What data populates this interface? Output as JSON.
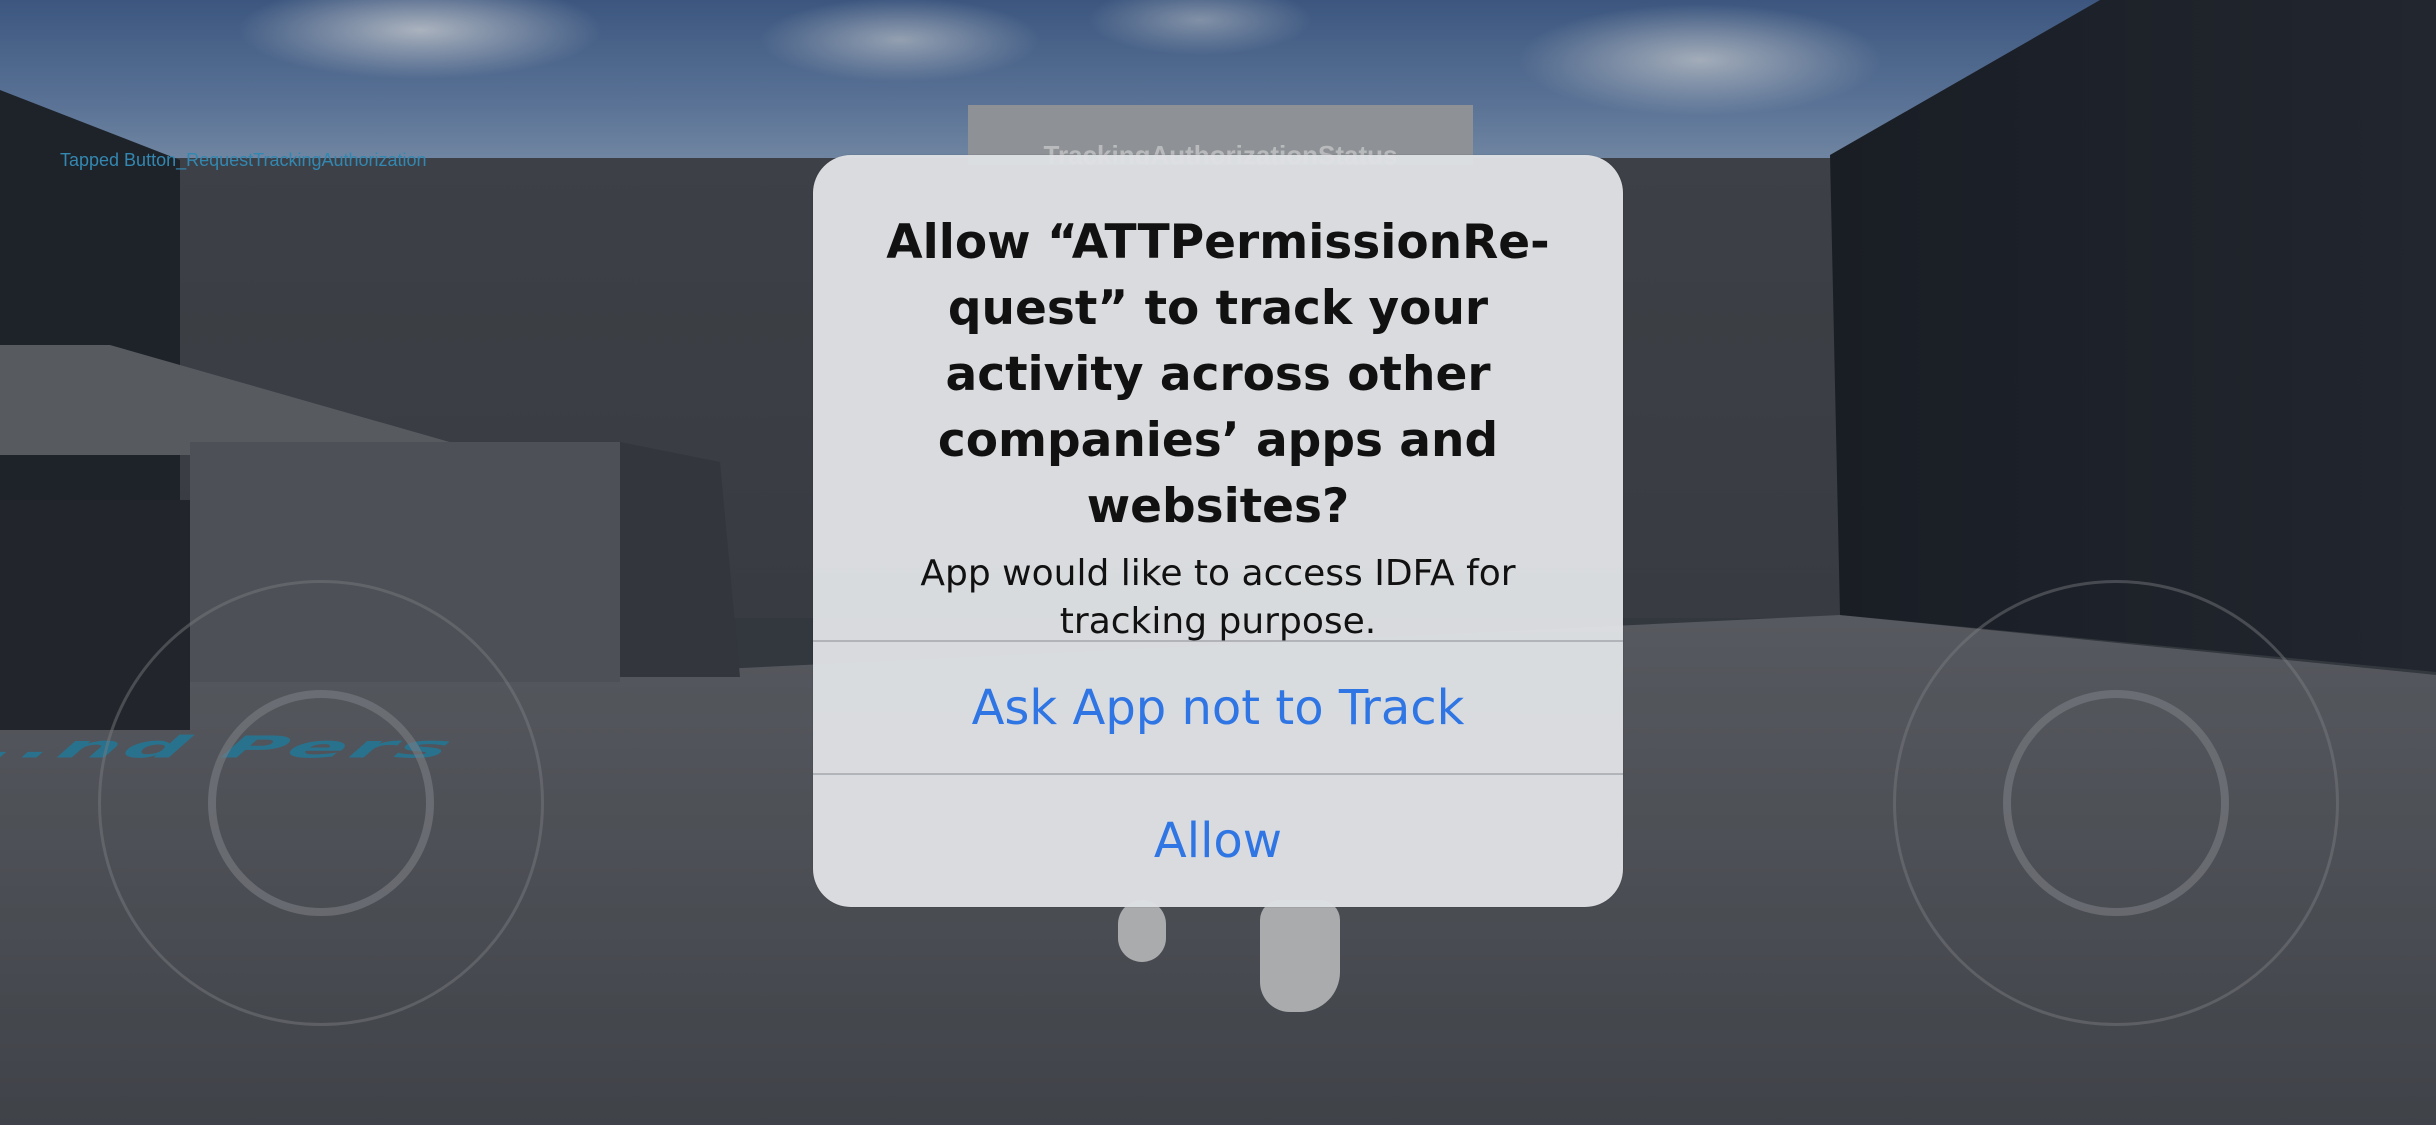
{
  "debug_text": "Tapped  Button_RequestTrackingAuthorization",
  "billboard_text": "TrackingAuthorizationStatus",
  "floor_text": "...nd Pers",
  "alert": {
    "title": "Allow “ATTPermissionRe-quest” to track your activity across other companies’ apps and websites?",
    "message": "App would like to access IDFA for tracking purpose.",
    "buttons": {
      "ask_not_to_track": "Ask App not to Track",
      "allow": "Allow"
    }
  },
  "colors": {
    "button_text": "#2f76e4",
    "debug_text": "#3fa6d8",
    "alert_background": "#dee0e3"
  }
}
